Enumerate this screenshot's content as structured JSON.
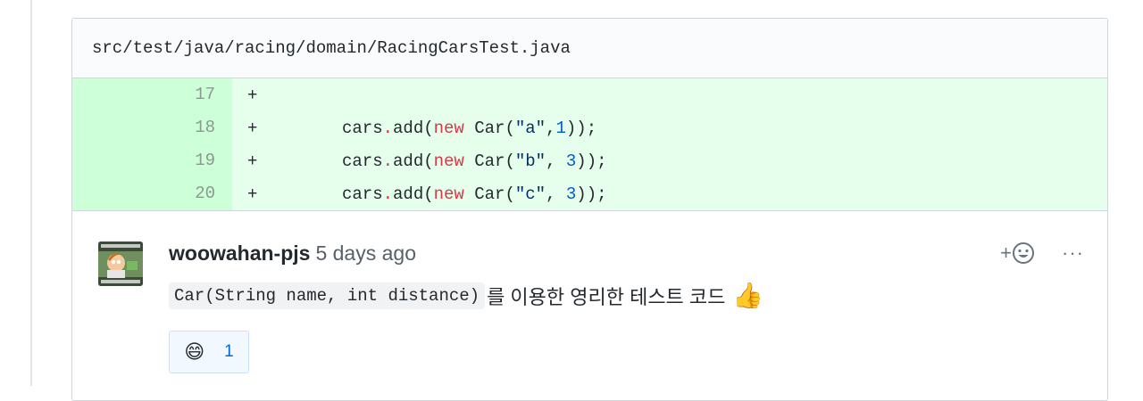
{
  "file": {
    "path": "src/test/java/racing/domain/RacingCarsTest.java"
  },
  "diff": {
    "lines": [
      {
        "num": "17",
        "marker": "+"
      },
      {
        "num": "18",
        "marker": "+",
        "var": "cars",
        "dot": ".",
        "call": "add(",
        "kw": "new",
        "cls": " Car(",
        "str": "\"a\"",
        "sep": ",",
        "n": "1",
        "end": "));"
      },
      {
        "num": "19",
        "marker": "+",
        "var": "cars",
        "dot": ".",
        "call": "add(",
        "kw": "new",
        "cls": " Car(",
        "str": "\"b\"",
        "sep": ", ",
        "n": "3",
        "end": "));"
      },
      {
        "num": "20",
        "marker": "+",
        "var": "cars",
        "dot": ".",
        "call": "add(",
        "kw": "new",
        "cls": " Car(",
        "str": "\"c\"",
        "sep": ", ",
        "n": "3",
        "end": "));"
      }
    ]
  },
  "comment": {
    "author": "woowahan-pjs",
    "time": "5 days ago",
    "code": "Car(String name, int distance)",
    "text": "를 이용한 영리한 테스트 코드",
    "emoji_icon": "thumbs-up-icon",
    "actions": {
      "add_reaction": "+",
      "more": "···"
    },
    "reaction": {
      "emoji": "😄",
      "emoji_icon": "grinning-face-icon",
      "count": "1"
    }
  },
  "colors": {
    "added_bg": "#e6ffed",
    "added_num_bg": "#cdffd8",
    "link": "#0366d6"
  }
}
